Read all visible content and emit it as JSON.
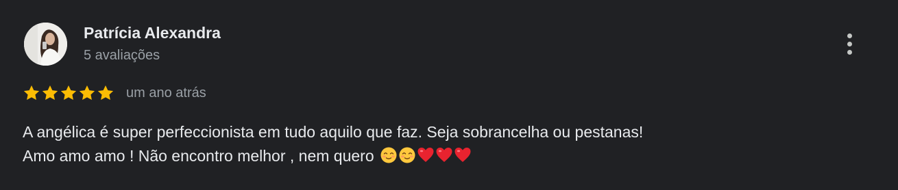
{
  "review": {
    "author": {
      "name": "Patrícia Alexandra",
      "meta": "5 avaliações",
      "avatar_icon": "profile-photo"
    },
    "rating": {
      "stars": 5,
      "max": 5,
      "star_color": "#fbbc04"
    },
    "date": "um ano atrás",
    "text_lines": [
      "A angélica é super perfeccionista em tudo aquilo que faz. Seja sobrancelha ou pestanas!",
      "Amo amo amo ! Não encontro melhor , nem quero"
    ],
    "emojis": [
      "smiling-face-icon",
      "smiling-face-icon",
      "red-heart-icon",
      "red-heart-icon",
      "red-heart-icon"
    ],
    "menu_icon": "more-vertical-icon",
    "colors": {
      "background": "#202124",
      "primary_text": "#e8eaed",
      "secondary_text": "#9aa0a6"
    }
  }
}
